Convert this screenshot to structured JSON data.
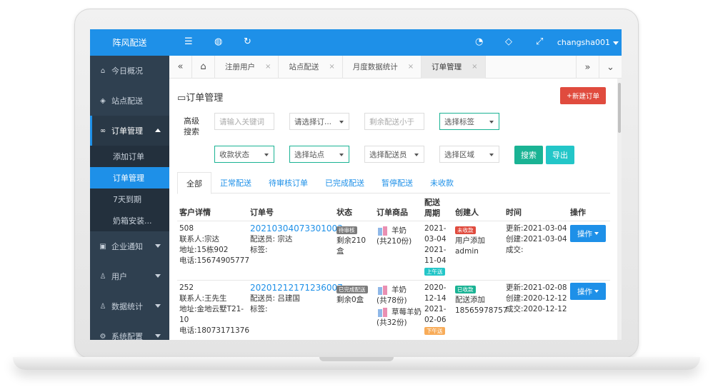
{
  "sidebar": {
    "brand": "阵风配送",
    "items": [
      {
        "label": "今日概况",
        "icon": "home-icon"
      },
      {
        "label": "站点配送",
        "icon": "cube-icon"
      },
      {
        "label": "订单管理",
        "icon": "link-icon"
      },
      {
        "label": "企业通知",
        "icon": "folder-icon"
      },
      {
        "label": "用户",
        "icon": "user-icon"
      },
      {
        "label": "数据统计",
        "icon": "users-icon"
      },
      {
        "label": "系统配置",
        "icon": "gear-icon"
      }
    ],
    "sub_items": [
      "添加订单",
      "订单管理",
      "7天到期",
      "奶箱安装..."
    ]
  },
  "topbar": {
    "user": "changsha001"
  },
  "tabstrip": {
    "tabs": [
      "注册用户",
      "站点配送",
      "月度数据统计",
      "订单管理"
    ]
  },
  "page": {
    "title": "订单管理",
    "new_button": "新建订单",
    "filter_label": "高级搜索",
    "keyword_placeholder": "请输入关键词",
    "order_type": "请选择订...",
    "remaining_placeholder": "剩余配送小于",
    "tag_select": "选择标签",
    "payment_status": "收款状态",
    "station_select": "选择站点",
    "courier_select": "选择配送员",
    "region_select": "选择区域",
    "search_button": "搜索",
    "export_button": "导出"
  },
  "status_tabs": [
    "全部",
    "正常配送",
    "待审核订单",
    "已完成配送",
    "暂停配送",
    "未收款"
  ],
  "table": {
    "headers": [
      "客户详情",
      "订单号",
      "状态",
      "订单商品",
      "配送周期",
      "创建人",
      "时间",
      "操作"
    ],
    "rows": [
      {
        "customer": [
          "508",
          "联系人:宗达",
          "地址:15栋902",
          "电话:15674905777"
        ],
        "order_no": "20210304073301003",
        "courier": "配送员: 宗达",
        "tag": "标签:",
        "status_badge": "待审核",
        "status_text": "剩余210盒",
        "products": [
          {
            "name": "羊奶",
            "qty": "(共210份)"
          }
        ],
        "period": [
          "2021-",
          "03-04",
          "2021-",
          "11-04"
        ],
        "period_badge": "上午送",
        "creator_badge": "未收款",
        "creator": [
          "用户添加",
          "admin"
        ],
        "time": [
          "更新:2021-03-04",
          "创建:2021-03-04",
          "成交:"
        ],
        "action": "操作"
      },
      {
        "customer": [
          "252",
          "联系人:王先生",
          "地址:金地云墅T21-",
          "10",
          "电话:18073171376"
        ],
        "order_no": "20201212171236007",
        "courier": "配送员: 吕建国",
        "tag": "标签:",
        "status_badge": "已完成配送",
        "status_text": "剩余0盒",
        "products": [
          {
            "name": "羊奶",
            "qty": "(共78份)"
          },
          {
            "name": "草莓羊奶",
            "qty": "(共32份)"
          }
        ],
        "period": [
          "2020-",
          "12-14",
          "2021-",
          "02-06"
        ],
        "period_badge": "下午送",
        "creator_badge": "已收款",
        "creator": [
          "配送添加",
          "18565978757"
        ],
        "time": [
          "更新:2021-02-08",
          "创建:2020-12-12",
          "成交:2020-12-12"
        ],
        "action": "操作"
      }
    ]
  },
  "colors": {
    "primary": "#1e90e8",
    "sidebar": "#2f4050",
    "danger": "#e04b3e",
    "success": "#1ab394",
    "info": "#23c6c8",
    "warning": "#f8ac59"
  }
}
